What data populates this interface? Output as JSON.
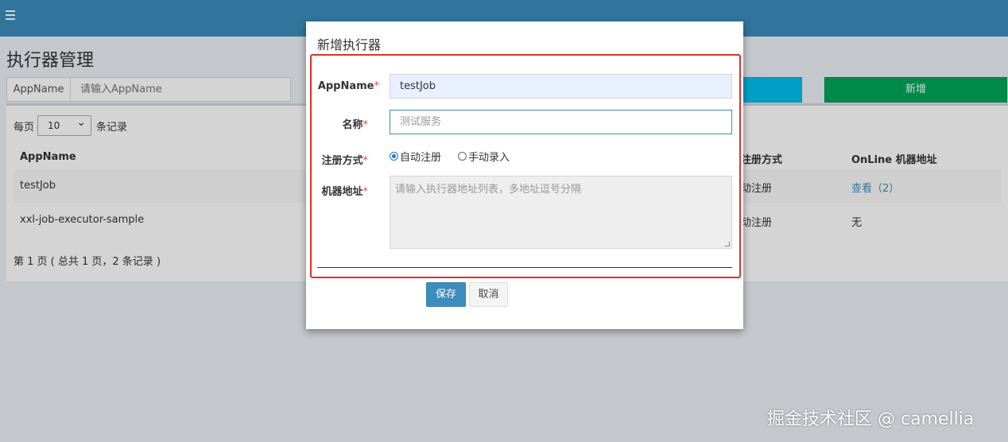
{
  "header": {
    "menu_icon": "hamburger-icon",
    "color": "#3c8dbc"
  },
  "page": {
    "title": "执行器管理"
  },
  "search": {
    "label": "AppName",
    "placeholder": "请输入AppName"
  },
  "toolbar": {
    "add_label": "新增"
  },
  "table": {
    "per_page_prefix": "每页",
    "per_page_value": "10",
    "per_page_suffix": "条记录",
    "columns": [
      "AppName",
      "注册方式",
      "OnLine 机器地址"
    ],
    "rows": [
      {
        "appname": "testJob",
        "register": "动注册",
        "online": "查看（2）"
      },
      {
        "appname": "xxl-job-executor-sample",
        "register": "动注册",
        "online": "无"
      }
    ],
    "pager": "第 1 页 ( 总共 1 页，2 条记录 )"
  },
  "modal": {
    "title": "新增执行器",
    "appname_label": "AppName",
    "appname_value": "testJob",
    "name_label": "名称",
    "name_value": "测试服务",
    "register_label": "注册方式",
    "register_options": [
      "自动注册",
      "手动录入"
    ],
    "address_label": "机器地址",
    "address_placeholder": "请输入执行器地址列表，多地址逗号分隔",
    "required_mark": "*",
    "save_label": "保存",
    "cancel_label": "取消",
    "highlight_color": "#e0302a"
  },
  "watermark": "掘金技术社区 @ camellia"
}
